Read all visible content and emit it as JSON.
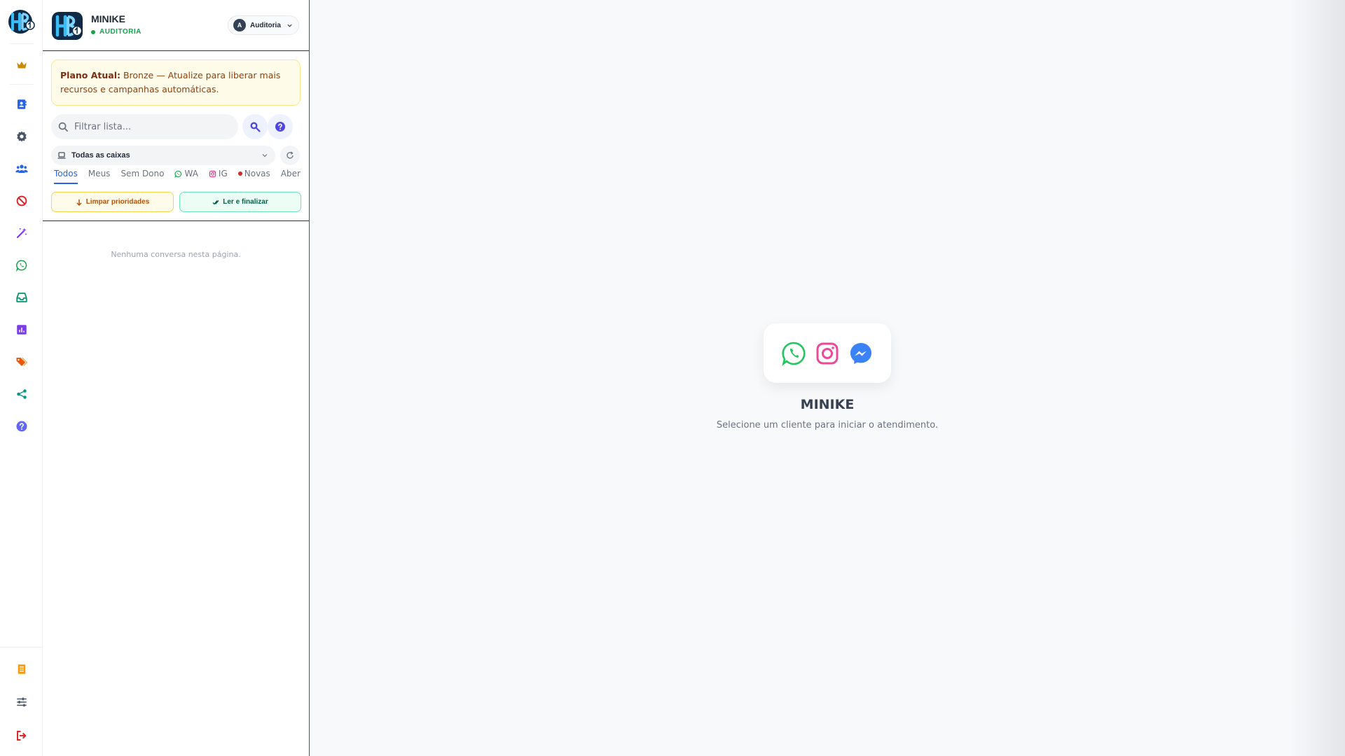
{
  "rail": {
    "logo": "hb-logo",
    "items": [
      {
        "name": "crown-icon",
        "color": "#ca8a04"
      },
      {
        "name": "contact-book-icon",
        "color": "#2563eb"
      },
      {
        "name": "gear-icon",
        "color": "#475569"
      },
      {
        "name": "users-icon",
        "color": "#2563eb"
      },
      {
        "name": "block-icon",
        "color": "#dc2626"
      },
      {
        "name": "magic-wand-icon",
        "color": "#7c3aed"
      },
      {
        "name": "whatsapp-icon",
        "color": "#16a34a"
      },
      {
        "name": "inbox-icon",
        "color": "#059669"
      },
      {
        "name": "chart-icon",
        "color": "#7c3aed"
      },
      {
        "name": "tags-icon",
        "color": "#ea580c"
      },
      {
        "name": "share-icon",
        "color": "#0d9488"
      },
      {
        "name": "help-icon",
        "color": "#6366f1"
      }
    ],
    "bottom_items": [
      {
        "name": "document-icon",
        "color": "#f59e0b"
      },
      {
        "name": "sliders-icon",
        "color": "#475569"
      },
      {
        "name": "logout-icon",
        "color": "#dc2626"
      }
    ]
  },
  "header": {
    "title": "MINIKE",
    "status": "AUDITORIA",
    "status_color": "#16a34a",
    "user": {
      "initial": "A",
      "name": "Auditoria"
    }
  },
  "plan": {
    "label": "Plano Atual:",
    "text": " Bronze — Atualize para liberar mais recursos e campanhas automáticas."
  },
  "search": {
    "placeholder": "Filtrar lista..."
  },
  "inbox": {
    "selected": "Todas as caixas"
  },
  "tabs": [
    {
      "label": "Todos",
      "active": true
    },
    {
      "label": "Meus"
    },
    {
      "label": "Sem Dono"
    },
    {
      "label": "WA",
      "icon": "whatsapp-icon"
    },
    {
      "label": "IG",
      "icon": "instagram-icon"
    },
    {
      "label": "Novas",
      "icon": "red-dot"
    },
    {
      "label": "Abert"
    }
  ],
  "actions": {
    "clear_label": "Limpar prioridades",
    "read_label": "Ler e finalizar"
  },
  "list": {
    "empty_message": "Nenhuma conversa nesta página."
  },
  "welcome": {
    "title": "MINIKE",
    "subtitle": "Selecione um cliente para iniciar o atendimento.",
    "channels": [
      "whatsapp-icon",
      "instagram-icon",
      "messenger-icon"
    ]
  }
}
